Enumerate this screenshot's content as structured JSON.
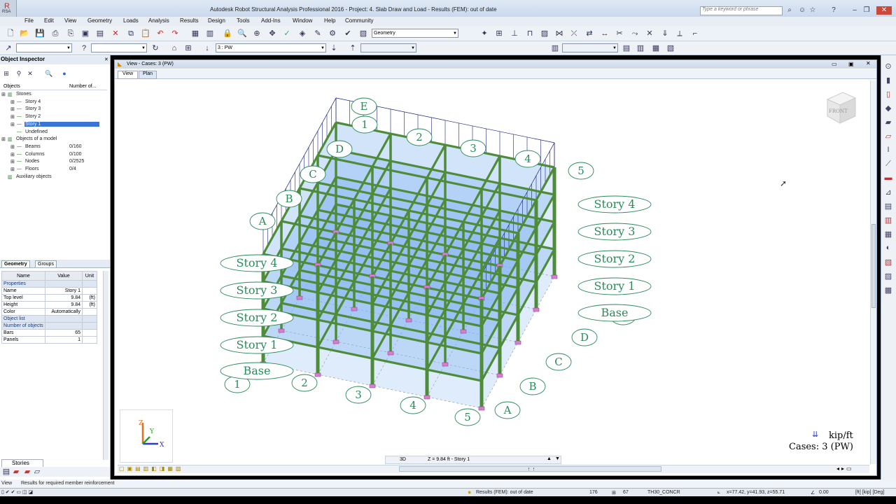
{
  "window": {
    "title": "Autodesk Robot Structural Analysis Professional 2016 - Project: 4. Slab Draw and Load - Results (FEM): out of date",
    "search_placeholder": "Type a keyword or phrase",
    "app_button": "RSA",
    "title_icons": [
      "binoculars-icon",
      "user-icon",
      "star-icon",
      "help-icon",
      "minimize-icon",
      "restore-icon",
      "close-icon"
    ]
  },
  "menu": [
    "File",
    "Edit",
    "View",
    "Geometry",
    "Loads",
    "Analysis",
    "Results",
    "Design",
    "Tools",
    "Add-Ins",
    "Window",
    "Help",
    "Community"
  ],
  "toolbar": {
    "layout_combo": "Geometry",
    "case_combo": "3 : PW"
  },
  "object_inspector": {
    "title": "Object Inspector",
    "columns": [
      "Objects",
      "Number of..."
    ],
    "tree": [
      {
        "label": "Stones",
        "count": "",
        "depth": 0,
        "selected": false
      },
      {
        "label": "Story 4",
        "count": "",
        "depth": 1,
        "selected": false
      },
      {
        "label": "Story 3",
        "count": "",
        "depth": 1,
        "selected": false
      },
      {
        "label": "Story 2",
        "count": "",
        "depth": 1,
        "selected": false
      },
      {
        "label": "Story 1",
        "count": "",
        "depth": 1,
        "selected": true
      },
      {
        "label": "Undefined",
        "count": "",
        "depth": 1,
        "selected": false
      },
      {
        "label": "Objects of a model",
        "count": "",
        "depth": 0,
        "selected": false
      },
      {
        "label": "Beams",
        "count": "0/160",
        "depth": 1,
        "selected": false
      },
      {
        "label": "Columns",
        "count": "0/100",
        "depth": 1,
        "selected": false
      },
      {
        "label": "Nodes",
        "count": "0/2525",
        "depth": 1,
        "selected": false
      },
      {
        "label": "Floors",
        "count": "0/4",
        "depth": 1,
        "selected": false
      },
      {
        "label": "Auxiliary objects",
        "count": "",
        "depth": 0,
        "selected": false
      }
    ],
    "tabs": [
      "Geometry",
      "Groups"
    ],
    "prop_headers": [
      "Name",
      "Value",
      "Unit"
    ],
    "props": [
      {
        "name": "Properties",
        "value": "",
        "unit": "",
        "section": true
      },
      {
        "name": "Name",
        "value": "Story 1",
        "unit": "",
        "section": false
      },
      {
        "name": "Top level",
        "value": "9.84",
        "unit": "(ft)",
        "section": false
      },
      {
        "name": "Height",
        "value": "9.84",
        "unit": "(ft)",
        "section": false
      },
      {
        "name": "Color",
        "value": "Automatically",
        "unit": "",
        "section": false
      },
      {
        "name": "Object list",
        "value": "",
        "unit": "",
        "section": true
      },
      {
        "name": "Number of objects",
        "value": "",
        "unit": "",
        "section": true
      },
      {
        "name": "Bars",
        "value": "65",
        "unit": "",
        "section": false
      },
      {
        "name": "Panels",
        "value": "1",
        "unit": "",
        "section": false
      }
    ],
    "bottom_tab": "Stories"
  },
  "view": {
    "title": "View - Cases: 3 (PW)",
    "tabs": [
      "View",
      "Plan"
    ],
    "viewcube": "FRONT",
    "units_label": "kip/ft",
    "cases_label": "Cases: 3 (PW)",
    "mode": "3D",
    "level": "Z = 9.84 ft - Story 1",
    "axis_labels": [
      "X",
      "Y",
      "Z"
    ]
  },
  "model": {
    "rows": [
      "A",
      "B",
      "C",
      "D",
      "E"
    ],
    "cols": [
      "1",
      "2",
      "3",
      "4",
      "5"
    ],
    "stories": [
      "Story 4",
      "Story 3",
      "Story 2",
      "Story 1",
      "Base"
    ],
    "colors": {
      "beam": "#4e8c3a",
      "glass": "#7fb2f0",
      "label": "#2a8a5a",
      "support": "#d57fd0"
    }
  },
  "hint": {
    "left": "View",
    "text": "Results for required member reinforcement"
  },
  "status": {
    "results": "Results (FEM): out of date",
    "n1": "176",
    "n2": "67",
    "section": "TH30_CONCR",
    "coords": "x=77.42, y=41.93, z=55.71",
    "angle": "0.00",
    "units": "[ft] [kip] [Deg]"
  }
}
